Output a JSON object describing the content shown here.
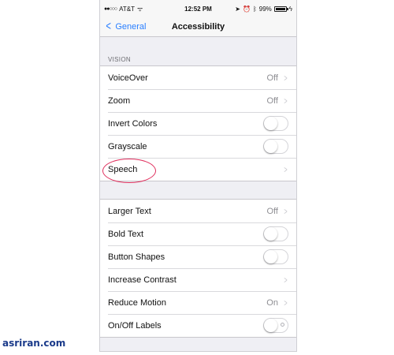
{
  "status": {
    "carrier": "AT&T",
    "time": "12:52 PM",
    "battery": "99%",
    "battery_level": 0.99
  },
  "nav": {
    "back_label": "General",
    "title": "Accessibility"
  },
  "sections": [
    {
      "header": "VISION",
      "rows": [
        {
          "label": "VoiceOver",
          "value": "Off"
        },
        {
          "label": "Zoom",
          "value": "Off"
        },
        {
          "label": "Invert Colors",
          "toggle": false
        },
        {
          "label": "Grayscale",
          "toggle": false
        },
        {
          "label": "Speech"
        }
      ]
    },
    {
      "rows": [
        {
          "label": "Larger Text",
          "value": "Off"
        },
        {
          "label": "Bold Text",
          "toggle": false
        },
        {
          "label": "Button Shapes",
          "toggle": false
        },
        {
          "label": "Increase Contrast"
        },
        {
          "label": "Reduce Motion",
          "value": "On"
        },
        {
          "label": "On/Off Labels",
          "toggle": false
        }
      ]
    }
  ],
  "watermark": "asriran.com",
  "colors": {
    "accent": "#2a7fff",
    "highlight": "#e0305e",
    "watermark": "#1a3a8a"
  }
}
